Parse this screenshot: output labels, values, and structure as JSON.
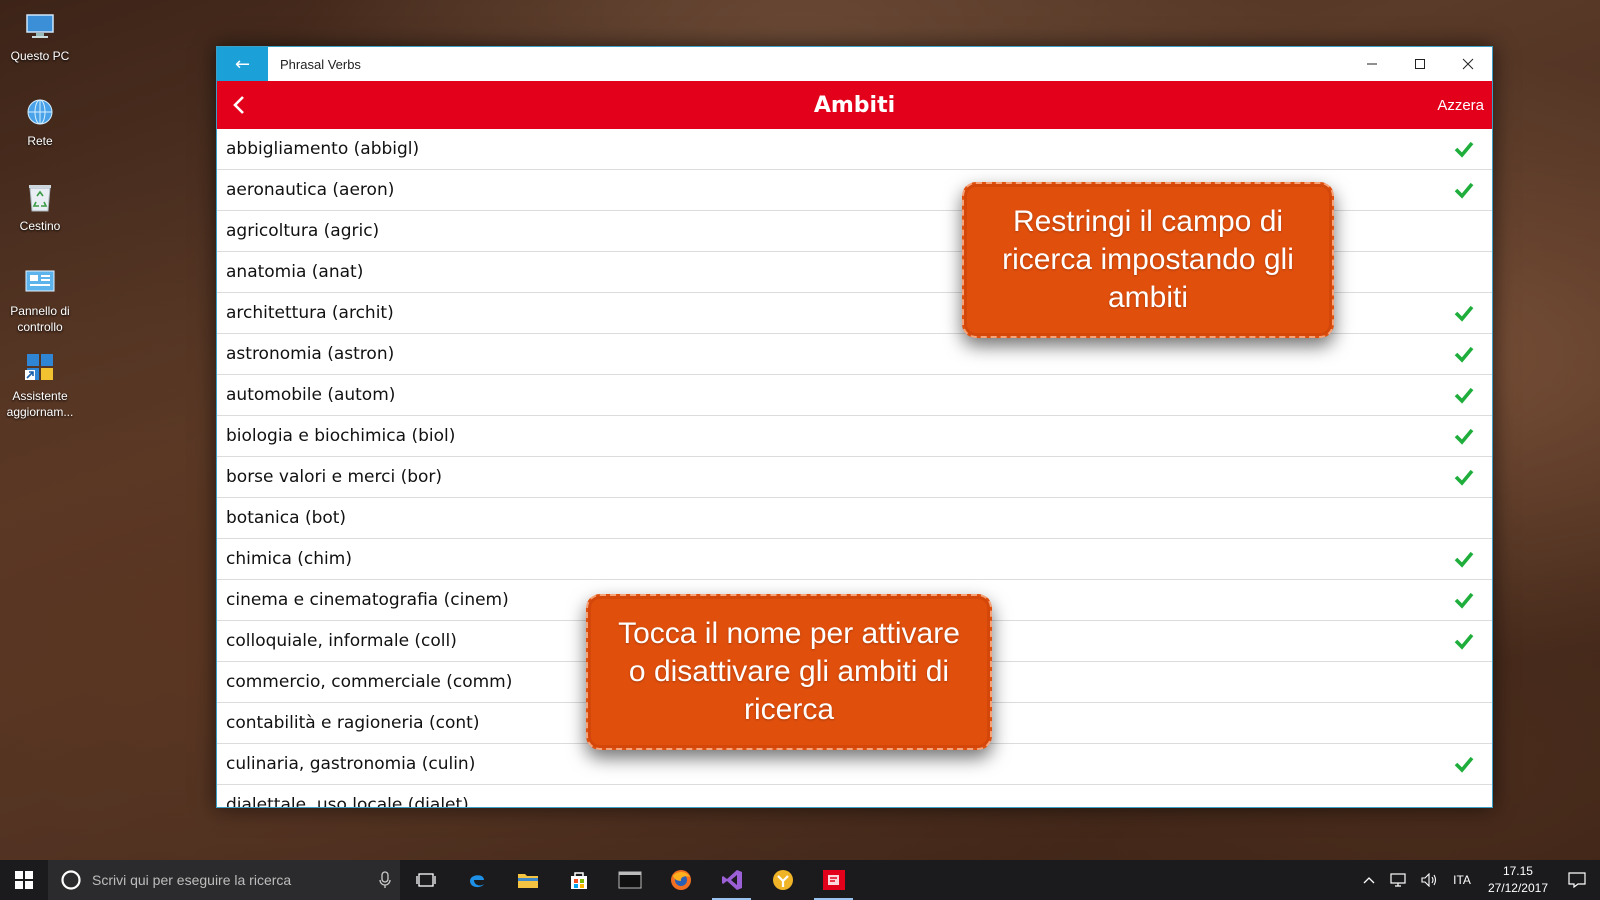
{
  "desktop": {
    "icons": [
      {
        "label": "Questo PC",
        "icon": "computer-icon"
      },
      {
        "label": "Rete",
        "icon": "network-icon"
      },
      {
        "label": "Cestino",
        "icon": "recycle-bin-icon"
      },
      {
        "label": "Pannello di controllo",
        "icon": "control-panel-icon"
      },
      {
        "label": "Assistente aggiornam...",
        "icon": "update-assistant-icon"
      }
    ]
  },
  "window": {
    "title": "Phrasal Verbs"
  },
  "appbar": {
    "title": "Ambiti",
    "reset_label": "Azzera",
    "accent": "#e3001b"
  },
  "domains": [
    {
      "name": "abbigliamento (abbigl)",
      "checked": true
    },
    {
      "name": "aeronautica (aeron)",
      "checked": true
    },
    {
      "name": "agricoltura (agric)",
      "checked": false
    },
    {
      "name": "anatomia (anat)",
      "checked": false
    },
    {
      "name": "architettura (archit)",
      "checked": true
    },
    {
      "name": "astronomia (astron)",
      "checked": true
    },
    {
      "name": "automobile (autom)",
      "checked": true
    },
    {
      "name": "biologia e biochimica (biol)",
      "checked": true
    },
    {
      "name": "borse valori e merci (bor)",
      "checked": true
    },
    {
      "name": "botanica (bot)",
      "checked": false
    },
    {
      "name": "chimica (chim)",
      "checked": true
    },
    {
      "name": "cinema e cinematografia (cinem)",
      "checked": true
    },
    {
      "name": "colloquiale, informale (coll)",
      "checked": true
    },
    {
      "name": "commercio, commerciale (comm)",
      "checked": false
    },
    {
      "name": "contabilità e ragioneria (cont)",
      "checked": false
    },
    {
      "name": "culinaria, gastronomia (culin)",
      "checked": true
    },
    {
      "name": "dialettale, uso locale (dialet)",
      "checked": false
    }
  ],
  "callouts": {
    "top": "Restringi il campo di ricerca impostando gli ambiti",
    "bottom": "Tocca il nome per attivare o disattivare gli ambiti di ricerca"
  },
  "taskbar": {
    "search_placeholder": "Scrivi qui per eseguire la ricerca",
    "language": "ITA",
    "time": "17.15",
    "date": "27/12/2017"
  }
}
